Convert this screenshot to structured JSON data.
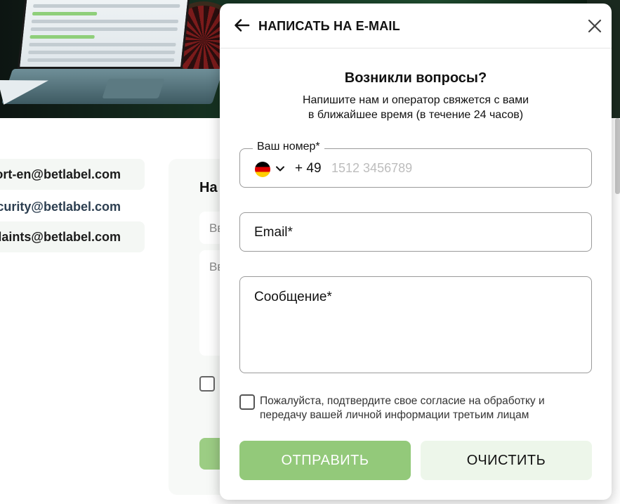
{
  "background": {
    "emails": [
      "support-en@betlabel.com",
      "security@betlabel.com",
      "complaints@betlabel.com"
    ],
    "form_title": "На",
    "input_placeholder_1": "Вв",
    "input_placeholder_2": "Вв"
  },
  "modal": {
    "title": "НАПИСАТЬ НА E-MAIL",
    "question_title": "Возникли вопросы?",
    "question_subtitle": "Напишите нам и оператор свяжется с вами в ближайшее время (в течение 24 часов)",
    "phone": {
      "label": "Ваш номер*",
      "country_code": "+ 49",
      "placeholder": "1512 3456789",
      "flag": "germany-flag"
    },
    "email_label": "Email*",
    "message_label": "Сообщение*",
    "consent_text": "Пожалуйста, подтвердите свое согласие на обработку и передачу вашей личной информации третьим лицам",
    "send_button": "ОТПРАВИТЬ",
    "clear_button": "ОЧИСТИТЬ"
  },
  "colors": {
    "accent_green": "#93c97a",
    "clear_bg": "#edf6ea"
  }
}
